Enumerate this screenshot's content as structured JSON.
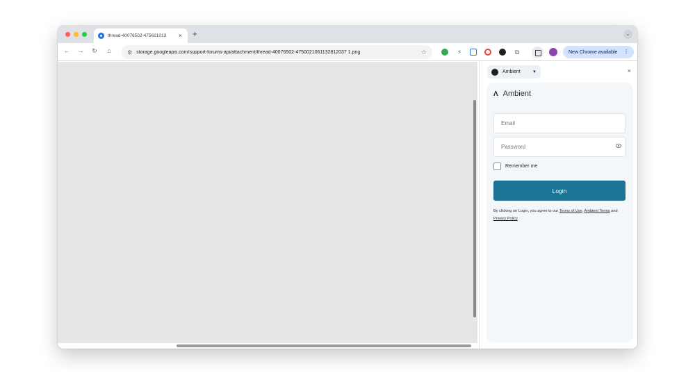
{
  "browser": {
    "tab_title": "thread-40076502-475621013",
    "tab_close": "×",
    "new_tab": "+",
    "tab_search": "⌄",
    "url": "storage.googleapis.com/support-forums-api/attachment/thread-40076502-4750021061132812037 1.png",
    "update_chip": "New Chrome available",
    "icons": {
      "back": "←",
      "forward": "→",
      "reload": "↻",
      "home": "⌂",
      "site_info": "⚙",
      "star": "☆",
      "menu": "⋮"
    },
    "colors": {
      "tab_strip": "#dee1e6",
      "chip": "#d3e3fd"
    }
  },
  "side_panel": {
    "extension_name": "Ambient",
    "close_icon": "×",
    "brand_name": "Ambient",
    "brand_logo": "Λ",
    "email_placeholder": "Email",
    "password_placeholder": "Password",
    "remember_label": "Remember me",
    "login_label": "Login",
    "legal": {
      "prefix": "By clicking on Login, you agree to our ",
      "terms_link": "Terms of Use",
      "sep1": ", ",
      "ambient_terms_link": "Ambient Terms",
      "sep2": " and ",
      "privacy_link": "Privacy Policy"
    },
    "colors": {
      "primary": "#1b7493",
      "card_bg": "#f3f7fa"
    }
  }
}
